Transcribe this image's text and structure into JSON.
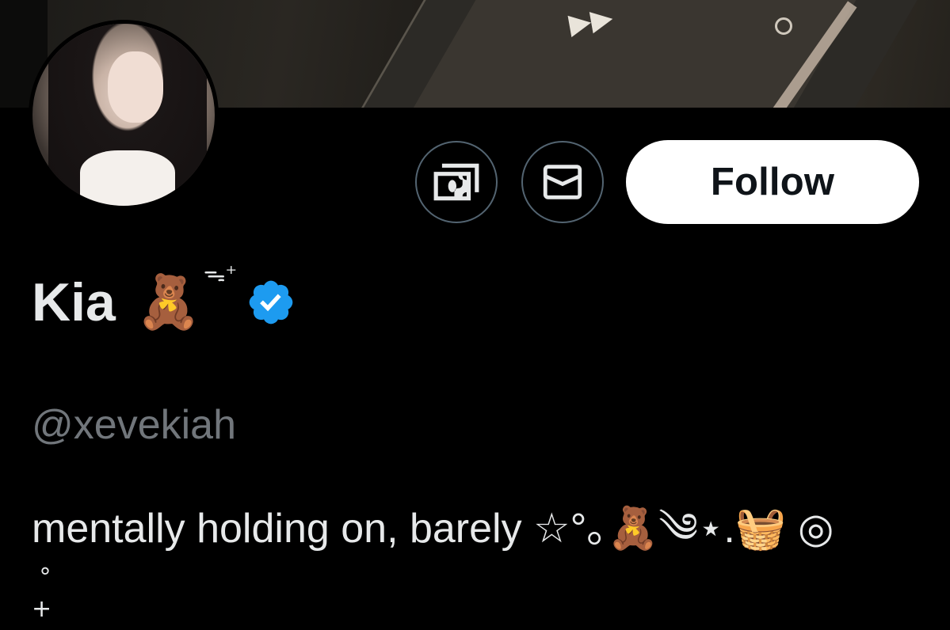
{
  "profile": {
    "display_name": "Kia",
    "name_emoji": "🧸",
    "name_decoration": "ᯓ⁺",
    "verified_icon": "verified-badge-icon",
    "handle": "@xevekiah",
    "bio_line1": "mentally holding on, barely ☆°｡🧸༄⋆.🧺 ◎",
    "bio_line2": " °\n+"
  },
  "actions": {
    "tip_icon": "money-icon",
    "message_icon": "envelope-icon",
    "follow_label": "Follow"
  },
  "colors": {
    "background": "#000000",
    "primary_text": "#e7e9ea",
    "secondary_text": "#71767b",
    "verified": "#1d9bf0",
    "button_border": "#536471",
    "follow_bg": "#ffffff",
    "follow_text": "#0f1419"
  }
}
